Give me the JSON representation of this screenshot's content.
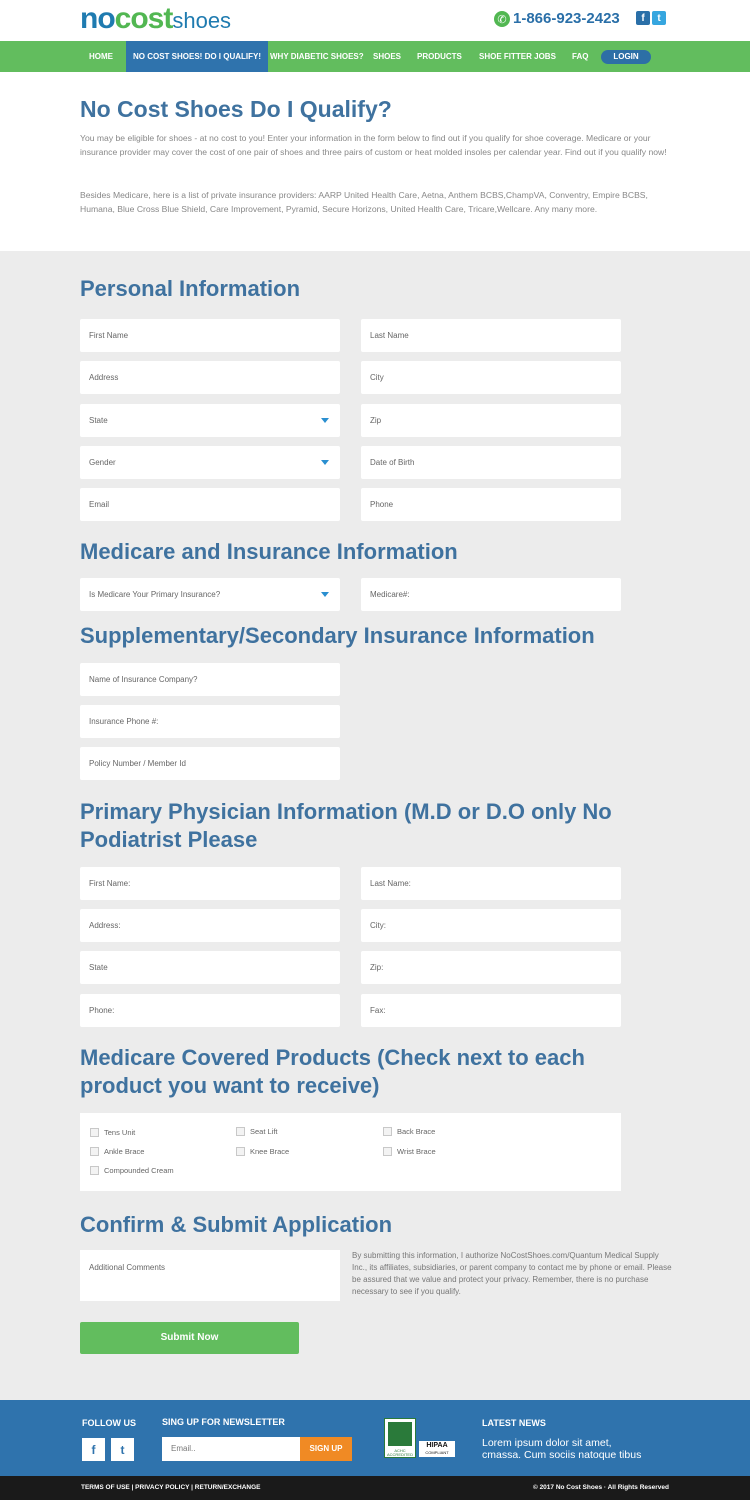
{
  "brand": {
    "logo_no": "no",
    "logo_cost": "cost",
    "logo_shoes": "shoes",
    "phone": "1-866-923-2423",
    "facebook_icon": "f",
    "twitter_icon": "t"
  },
  "colors": {
    "nav": "#62bd5e",
    "nav_active": "#2f73ad",
    "heading": "#3f729f",
    "submit": "#62bd5e",
    "newsletter_button": "#f08a24",
    "footer": "#2f73ad"
  },
  "nav": {
    "items": [
      "HOME",
      "NO COST SHOES! DO I QUALIFY!",
      "WHY DIABETIC SHOES?",
      "SHOES",
      "PRODUCTS",
      "SHOE FITTER JOBS",
      "FAQ"
    ],
    "login": "LOGIN"
  },
  "intro": {
    "title": "No Cost Shoes Do I Qualify?",
    "p1": "You may be eligible for shoes - at no cost to you! Enter your information in the form below to find out if you qualify for shoe coverage. Medicare or your insurance provider may cover the cost of one pair of shoes and three pairs of custom or heat molded insoles per calendar year. Find out if you qualify now!",
    "p2": "Besides Medicare, here is a list of private insurance providers: AARP United Health Care, Aetna, Anthem BCBS,ChampVA, Conventry, Empire BCBS, Humana, Blue Cross Blue Shield, Care Improvement, Pyramid, Secure Horizons, United Health Care, Tricare,Wellcare. Any many more."
  },
  "personal": {
    "title": "Personal Information",
    "first_name": "First Name",
    "last_name": "Last Name",
    "address": "Address",
    "city": "City",
    "state": "State",
    "zip": "Zip",
    "gender": "Gender",
    "dob": "Date of Birth",
    "email": "Email",
    "phone": "Phone"
  },
  "medicare": {
    "title": "Medicare and Insurance Information",
    "primary": "Is Medicare Your Primary Insurance?",
    "number": "Medicare#:"
  },
  "supplementary": {
    "title": "Supplementary/Secondary Insurance Information",
    "company": "Name of Insurance Company?",
    "phone": "Insurance Phone #:",
    "policy": "Policy Number / Member Id"
  },
  "physician": {
    "title": "Primary Physician Information (M.D or D.O only No Podiatrist Please",
    "first_name": "First Name:",
    "last_name": "Last Name:",
    "address": "Address:",
    "city": "City:",
    "state": "State",
    "zip": "Zip:",
    "phone": "Phone:",
    "fax": "Fax:"
  },
  "products": {
    "title": "Medicare Covered Products (Check next to each product you want to receive)",
    "items": [
      "Tens Unit",
      "Seat Lift",
      "Back Brace",
      "Ankle Brace",
      "Knee Brace",
      "Wrist Brace",
      "Compounded Cream"
    ]
  },
  "confirm": {
    "title": "Confirm & Submit Application",
    "comments": "Additional Comments",
    "consent": "By submitting this information, I authorize NoCostShoes.com/Quantum Medical Supply Inc., its affiliates, subsidiaries, or parent company to contact me by phone or email. Please be assured that we value and protect your privacy. Remember, there is no purchase necessary to see if you qualify.",
    "submit": "Submit Now"
  },
  "footer": {
    "follow": "FOLLOW US",
    "newsletter": "SING UP FOR NEWSLETTER",
    "email_placeholder": "Email..",
    "signup": "SIGN UP",
    "achc": "ACHC ACCREDITED",
    "hipaa": "HIPAA",
    "hipaa_sub": "COMPLIANT",
    "latest": "LATEST NEWS",
    "news_text": "Lorem ipsum dolor sit amet, cmassa. Cum sociis natoque tibus",
    "links": "TERMS OF USE  |  PRIVACY POLICY  |   RETURN/EXCHANGE",
    "copyright": "© 2017 No Cost Shoes ·  All Rights Reserved"
  }
}
